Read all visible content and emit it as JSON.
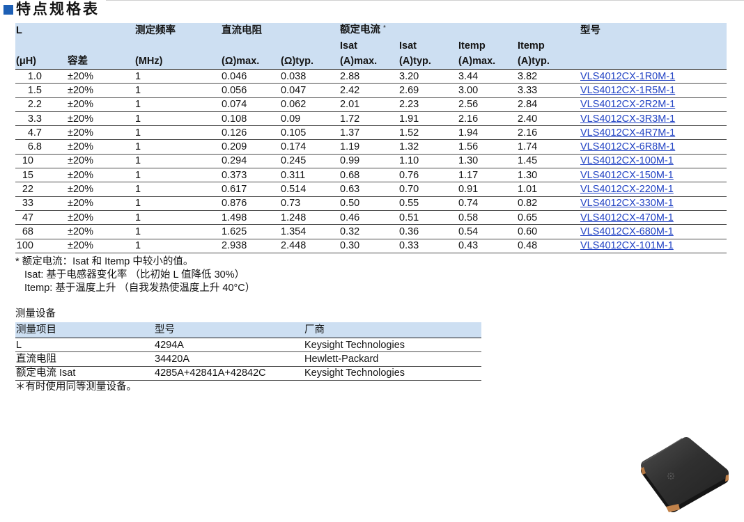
{
  "title": "特点规格表",
  "colors": {
    "title_bullet": "#1d5fb5",
    "header_background": "#cddff2",
    "link": "#2243c4"
  },
  "spec_table": {
    "header": {
      "l": "L",
      "freq": "测定频率",
      "rdc": "直流电阻",
      "rated_current": "额定电流",
      "rated_current_mark": "*",
      "part_no": "型号",
      "isat_max": "Isat",
      "isat_typ": "Isat",
      "itemp_max": "Itemp",
      "itemp_typ": "Itemp",
      "l_unit": "(μH)",
      "tolerance": "容差",
      "freq_unit": "(MHz)",
      "rdc_max_unit": "(Ω)max.",
      "rdc_typ_unit": "(Ω)typ.",
      "isat_max_unit": "(A)max.",
      "isat_typ_unit": "(A)typ.",
      "itemp_max_unit": "(A)max.",
      "itemp_typ_unit": "(A)typ."
    },
    "rows": [
      {
        "l": "1.0",
        "tolerance": "±20%",
        "freq": "1",
        "rdc_max": "0.046",
        "rdc_typ": "0.038",
        "isat_max": "2.88",
        "isat_typ": "3.20",
        "itemp_max": "3.44",
        "itemp_typ": "3.82",
        "part_no": "VLS4012CX-1R0M-1"
      },
      {
        "l": "1.5",
        "tolerance": "±20%",
        "freq": "1",
        "rdc_max": "0.056",
        "rdc_typ": "0.047",
        "isat_max": "2.42",
        "isat_typ": "2.69",
        "itemp_max": "3.00",
        "itemp_typ": "3.33",
        "part_no": "VLS4012CX-1R5M-1"
      },
      {
        "l": "2.2",
        "tolerance": "±20%",
        "freq": "1",
        "rdc_max": "0.074",
        "rdc_typ": "0.062",
        "isat_max": "2.01",
        "isat_typ": "2.23",
        "itemp_max": "2.56",
        "itemp_typ": "2.84",
        "part_no": "VLS4012CX-2R2M-1"
      },
      {
        "l": "3.3",
        "tolerance": "±20%",
        "freq": "1",
        "rdc_max": "0.108",
        "rdc_typ": "0.09",
        "isat_max": "1.72",
        "isat_typ": "1.91",
        "itemp_max": "2.16",
        "itemp_typ": "2.40",
        "part_no": "VLS4012CX-3R3M-1"
      },
      {
        "l": "4.7",
        "tolerance": "±20%",
        "freq": "1",
        "rdc_max": "0.126",
        "rdc_typ": "0.105",
        "isat_max": "1.37",
        "isat_typ": "1.52",
        "itemp_max": "1.94",
        "itemp_typ": "2.16",
        "part_no": "VLS4012CX-4R7M-1"
      },
      {
        "l": "6.8",
        "tolerance": "±20%",
        "freq": "1",
        "rdc_max": "0.209",
        "rdc_typ": "0.174",
        "isat_max": "1.19",
        "isat_typ": "1.32",
        "itemp_max": "1.56",
        "itemp_typ": "1.74",
        "part_no": "VLS4012CX-6R8M-1"
      },
      {
        "l": "10",
        "tolerance": "±20%",
        "freq": "1",
        "rdc_max": "0.294",
        "rdc_typ": "0.245",
        "isat_max": "0.99",
        "isat_typ": "1.10",
        "itemp_max": "1.30",
        "itemp_typ": "1.45",
        "part_no": "VLS4012CX-100M-1"
      },
      {
        "l": "15",
        "tolerance": "±20%",
        "freq": "1",
        "rdc_max": "0.373",
        "rdc_typ": "0.311",
        "isat_max": "0.68",
        "isat_typ": "0.76",
        "itemp_max": "1.17",
        "itemp_typ": "1.30",
        "part_no": "VLS4012CX-150M-1"
      },
      {
        "l": "22",
        "tolerance": "±20%",
        "freq": "1",
        "rdc_max": "0.617",
        "rdc_typ": "0.514",
        "isat_max": "0.63",
        "isat_typ": "0.70",
        "itemp_max": "0.91",
        "itemp_typ": "1.01",
        "part_no": "VLS4012CX-220M-1"
      },
      {
        "l": "33",
        "tolerance": "±20%",
        "freq": "1",
        "rdc_max": "0.876",
        "rdc_typ": "0.73",
        "isat_max": "0.50",
        "isat_typ": "0.55",
        "itemp_max": "0.74",
        "itemp_typ": "0.82",
        "part_no": "VLS4012CX-330M-1"
      },
      {
        "l": "47",
        "tolerance": "±20%",
        "freq": "1",
        "rdc_max": "1.498",
        "rdc_typ": "1.248",
        "isat_max": "0.46",
        "isat_typ": "0.51",
        "itemp_max": "0.58",
        "itemp_typ": "0.65",
        "part_no": "VLS4012CX-470M-1"
      },
      {
        "l": "68",
        "tolerance": "±20%",
        "freq": "1",
        "rdc_max": "1.625",
        "rdc_typ": "1.354",
        "isat_max": "0.32",
        "isat_typ": "0.36",
        "itemp_max": "0.54",
        "itemp_typ": "0.60",
        "part_no": "VLS4012CX-680M-1"
      },
      {
        "l": "100",
        "tolerance": "±20%",
        "freq": "1",
        "rdc_max": "2.938",
        "rdc_typ": "2.448",
        "isat_max": "0.30",
        "isat_typ": "0.33",
        "itemp_max": "0.43",
        "itemp_typ": "0.48",
        "part_no": "VLS4012CX-101M-1"
      }
    ]
  },
  "notes": [
    "* 额定电流：Isat 和 Itemp 中较小的值。",
    "Isat: 基于电感器变化率 （比初始 L 值降低 30%）",
    "Itemp: 基于温度上升 （自我发热使温度上升 40°C）"
  ],
  "equipment": {
    "title": "测量设备",
    "headers": {
      "item": "测量项目",
      "model": "型号",
      "maker": "厂商"
    },
    "rows": [
      {
        "item": "L",
        "model": "4294A",
        "maker": "Keysight Technologies"
      },
      {
        "item": "直流电阻",
        "model": "34420A",
        "maker": "Hewlett-Packard"
      },
      {
        "item": "额定电流 Isat",
        "model": "4285A+42841A+42842C",
        "maker": "Keysight Technologies"
      }
    ],
    "note": "＊有时使用同等测量设备。"
  }
}
